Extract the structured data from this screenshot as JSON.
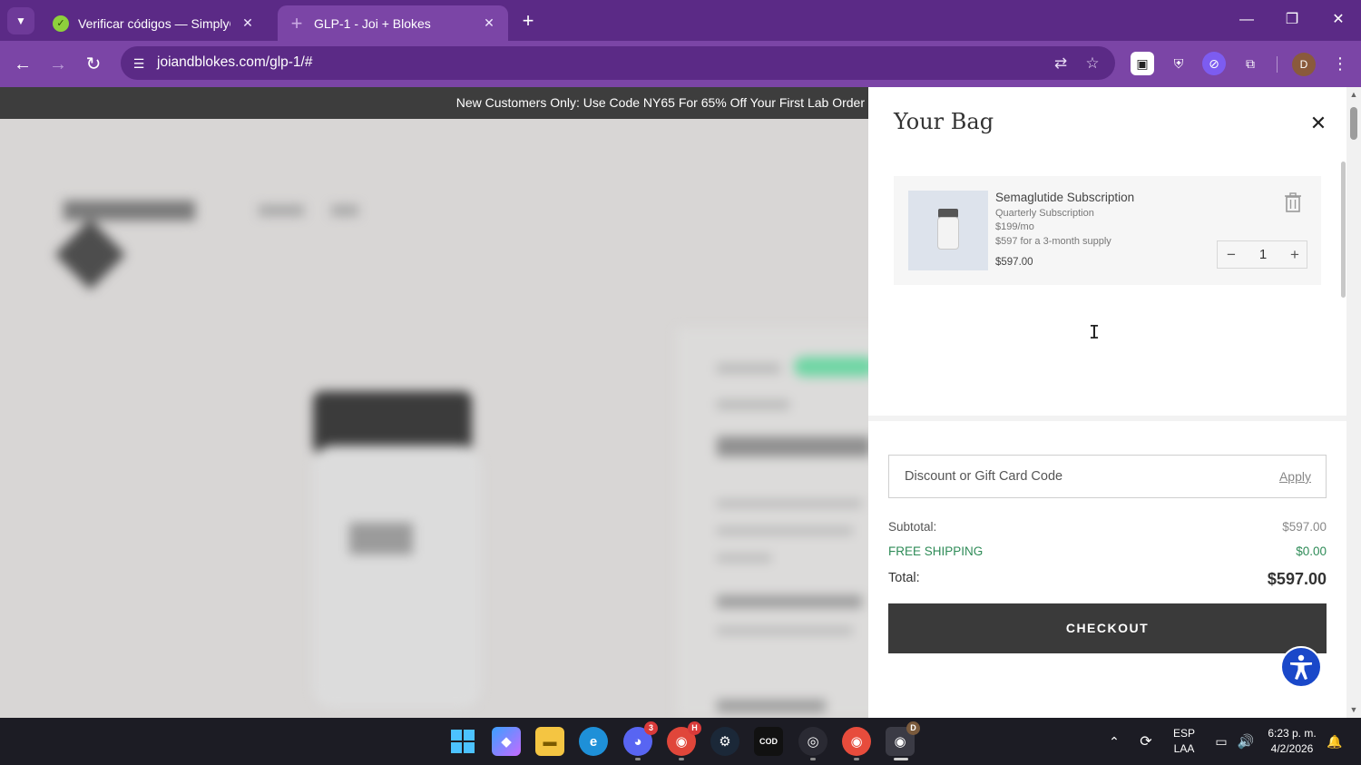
{
  "browser": {
    "tabs": [
      {
        "title": "Verificar códigos — SimplyCode",
        "active": false
      },
      {
        "title": "GLP-1 - Joi + Blokes",
        "active": true
      }
    ],
    "url": "joiandblokes.com/glp-1/#",
    "profile_initial": "D",
    "accent_color": "#7b45a6"
  },
  "page": {
    "promo_banner": "New Customers Only: Use Code NY65 For 65% Off Your First Lab Order"
  },
  "cart": {
    "title": "Your Bag",
    "item": {
      "name": "Semaglutide Subscription",
      "plan": "Quarterly Subscription",
      "monthly": "$199/mo",
      "supply": "$597 for a 3-month supply",
      "price": "$597.00",
      "quantity": "1"
    },
    "discount_placeholder": "Discount or Gift Card Code",
    "apply_label": "Apply",
    "subtotal_label": "Subtotal:",
    "subtotal_value": "$597.00",
    "shipping_label": "FREE SHIPPING",
    "shipping_value": "$0.00",
    "total_label": "Total:",
    "total_value": "$597.00",
    "checkout_label": "CHECKOUT",
    "shipping_color": "#2e8b57",
    "checkout_color": "#3a3a3a"
  },
  "taskbar": {
    "discord_badge": "3",
    "chrome_badge": "H",
    "chrome_profile_badge": "D",
    "language": "ESP",
    "layout": "LAA",
    "time": "6:23 p. m.",
    "date": "4/2/2026"
  }
}
